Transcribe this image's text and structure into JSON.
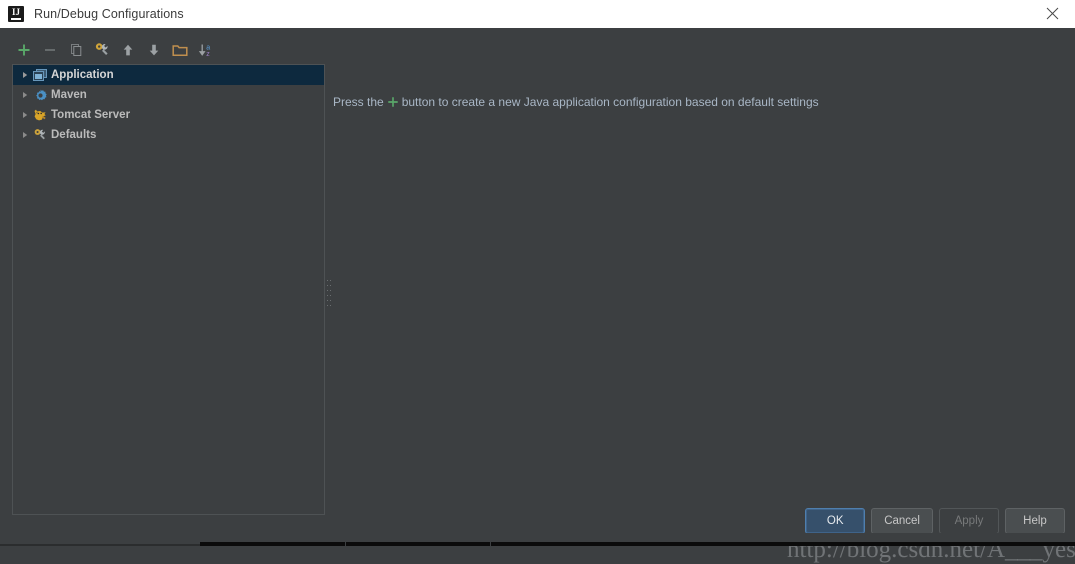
{
  "window": {
    "title": "Run/Debug Configurations",
    "logo_icon": "intellij-idea-logo",
    "close_icon": "close-icon"
  },
  "toolbar": {
    "items": [
      {
        "name": "add-configuration-button",
        "icon": "plus-icon",
        "label": "Add New Configuration",
        "enabled": true
      },
      {
        "name": "remove-configuration-button",
        "icon": "minus-icon",
        "label": "Remove Configuration",
        "enabled": false
      },
      {
        "name": "copy-configuration-button",
        "icon": "copy-icon",
        "label": "Copy Configuration",
        "enabled": false
      },
      {
        "name": "edit-defaults-button",
        "icon": "wrench-gear-icon",
        "label": "Edit defaults",
        "enabled": true
      },
      {
        "name": "move-up-button",
        "icon": "arrow-up-icon",
        "label": "Move Up",
        "enabled": true
      },
      {
        "name": "move-down-button",
        "icon": "arrow-down-icon",
        "label": "Move Down",
        "enabled": true
      },
      {
        "name": "create-folder-button",
        "icon": "folder-icon",
        "label": "Create New Folder",
        "enabled": true
      },
      {
        "name": "sort-alphabetically-button",
        "icon": "sort-az-icon",
        "label": "Sort Configurations",
        "enabled": true
      }
    ]
  },
  "tree": {
    "items": [
      {
        "label": "Application",
        "icon": "application-icon",
        "expand_icon": "triangle-right-icon",
        "selected": true
      },
      {
        "label": "Maven",
        "icon": "maven-gear-icon",
        "expand_icon": "triangle-right-icon",
        "selected": false
      },
      {
        "label": "Tomcat Server",
        "icon": "tomcat-cat-icon",
        "expand_icon": "triangle-right-icon",
        "selected": false
      },
      {
        "label": "Defaults",
        "icon": "wrench-gear-icon",
        "expand_icon": "triangle-right-icon",
        "selected": false
      }
    ]
  },
  "splitter": {
    "name": "panel-splitter",
    "grip_icon": "drag-grip-icon"
  },
  "hint": {
    "prefix": "Press the",
    "plus_icon": "plus-icon",
    "suffix": "button to create a new Java application configuration based on default settings"
  },
  "buttons": [
    {
      "name": "ok-button",
      "label": "OK",
      "style": "default",
      "enabled": true
    },
    {
      "name": "cancel-button",
      "label": "Cancel",
      "style": "normal",
      "enabled": true
    },
    {
      "name": "apply-button",
      "label": "Apply",
      "style": "disabled",
      "enabled": false
    },
    {
      "name": "help-button",
      "label": "Help",
      "style": "normal",
      "enabled": true
    }
  ],
  "watermark": {
    "text": "http://blog.csdn.net/A___yes"
  },
  "colors": {
    "dialog_background": "#3c3f41",
    "titlebar_background": "#ffffff",
    "selection_background": "#0d293e",
    "accent_green": "#59a869",
    "text_primary": "#bbbbbb",
    "hint_text": "#a9b7c6",
    "default_button": "#36506b"
  }
}
